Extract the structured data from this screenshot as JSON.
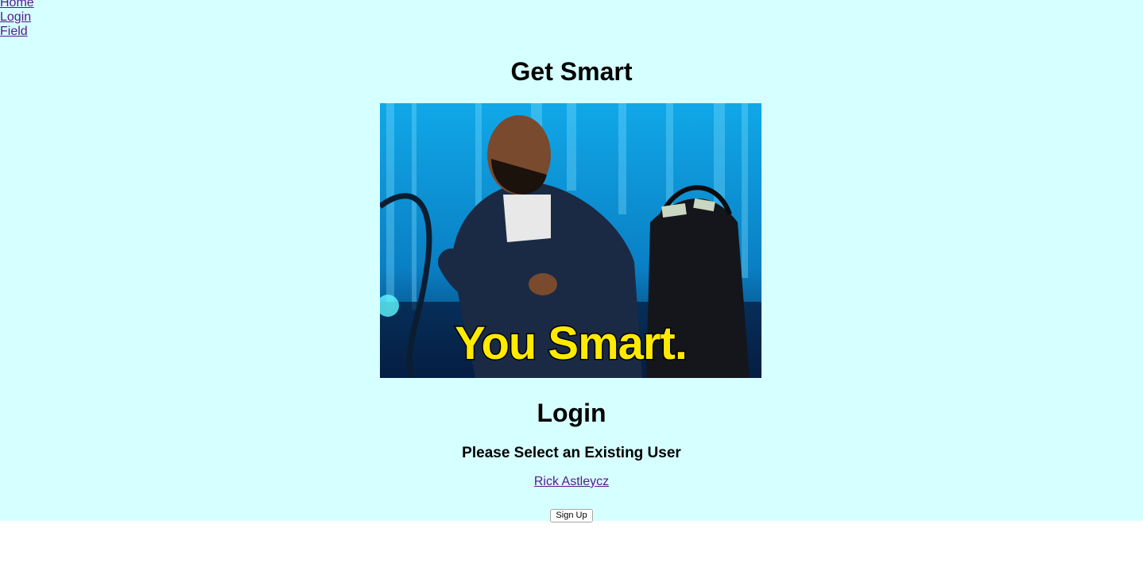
{
  "nav": {
    "links": [
      "Home",
      "Login",
      "Field"
    ]
  },
  "header": {
    "title": "Get Smart"
  },
  "media": {
    "gif_caption": "You Smart."
  },
  "login": {
    "heading": "Login",
    "subheading": "Please Select an Existing User",
    "users": [
      "Rick Astleycz"
    ],
    "signup_label": "Sign Up"
  },
  "colors": {
    "page_background": "#d6ffff",
    "link": "#551a8b",
    "gif_caption": "#ffea00"
  }
}
